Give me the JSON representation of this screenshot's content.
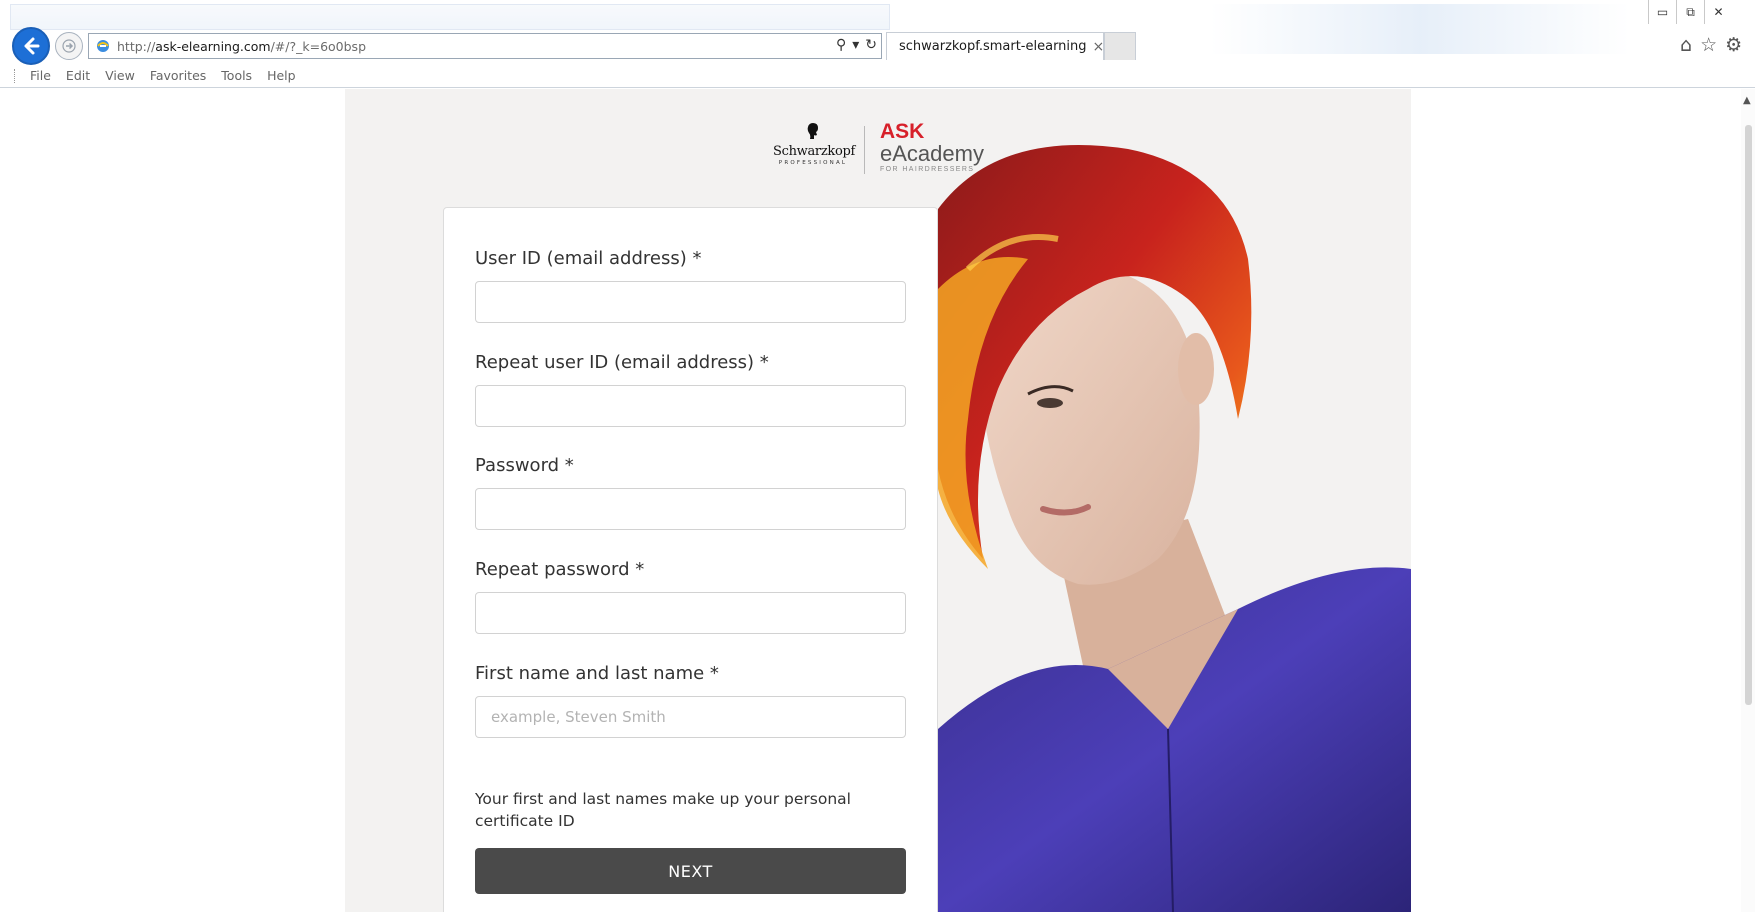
{
  "browser": {
    "url_scheme": "http://",
    "url_host": "ask-elearning.com",
    "url_rest": "/#/?_k=6o0bsp",
    "tab_title": "schwarzkopf.smart-elearning",
    "menu": [
      "File",
      "Edit",
      "View",
      "Favorites",
      "Tools",
      "Help"
    ],
    "window_controls": [
      "▭",
      "⧉",
      "✕"
    ]
  },
  "brand": {
    "schwarzkopf_name": "Schwarzkopf",
    "schwarzkopf_sub": "PROFESSIONAL",
    "ask_top": "ASK",
    "ask_mid": "eAcademy",
    "ask_sub": "FOR HAIRDRESSERS",
    "accent_color": "#d7202a"
  },
  "form": {
    "user_id_label": "User ID (email address) *",
    "repeat_user_id_label": "Repeat user ID (email address) *",
    "password_label": "Password *",
    "repeat_password_label": "Repeat password *",
    "name_label": "First name and last name *",
    "name_placeholder": "example, Steven Smith",
    "hint": "Your first and last names make up your personal certificate ID",
    "next_label": "NEXT"
  },
  "colors": {
    "button_bg": "#4a4a4a",
    "page_bg": "#f3f2f1",
    "browser_accent": "#1d6fd6"
  }
}
